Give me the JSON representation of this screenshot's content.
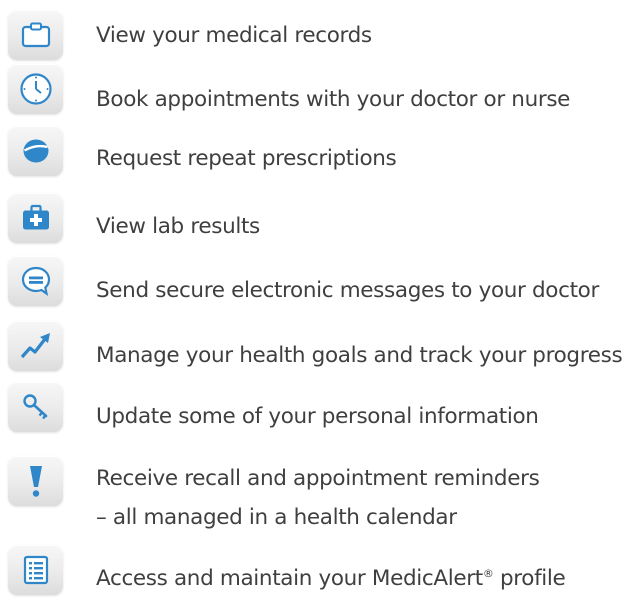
{
  "features": [
    {
      "icon": "clipboard-icon",
      "label": "View your medical records"
    },
    {
      "icon": "clock-icon",
      "label": "Book appointments with your doctor or nurse"
    },
    {
      "icon": "pill-icon",
      "label": "Request repeat prescriptions"
    },
    {
      "icon": "medical-kit-icon",
      "label": "View lab results"
    },
    {
      "icon": "message-bubble-icon",
      "label": "Send secure electronic messages to your doctor"
    },
    {
      "icon": "trend-arrow-icon",
      "label": "Manage your health goals and track your progress"
    },
    {
      "icon": "key-icon",
      "label": "Update some of your personal information"
    },
    {
      "icon": "exclamation-icon",
      "label_line1": "Receive recall and appointment reminders",
      "label_line2": "– all managed in a health calendar"
    },
    {
      "icon": "list-document-icon",
      "label_main": "Access and maintain your MedicAlert",
      "label_mark": "®",
      "label_tail": " profile"
    }
  ],
  "colors": {
    "icon_blue": "#2f86c9",
    "text": "#3f3f3f",
    "tile": "#ebebeb"
  }
}
